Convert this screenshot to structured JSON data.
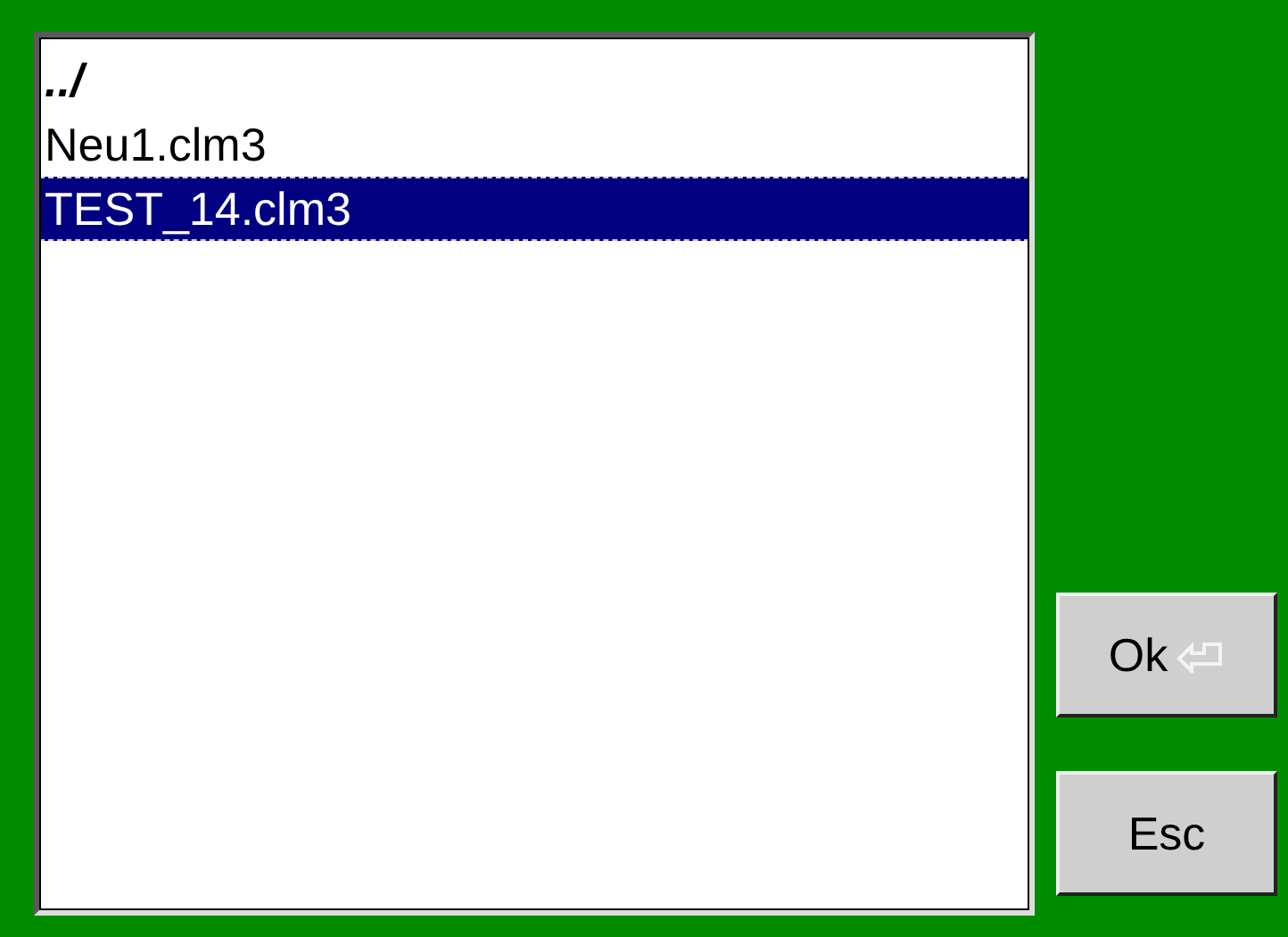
{
  "files": [
    {
      "name": "../",
      "kind": "parent",
      "selected": false
    },
    {
      "name": "Neu1.clm3",
      "kind": "file",
      "selected": false
    },
    {
      "name": "TEST_14.clm3",
      "kind": "file",
      "selected": true
    }
  ],
  "buttons": [
    {
      "label": "Ok",
      "kind": "enter"
    },
    {
      "label": "Esc",
      "kind": "plain"
    }
  ]
}
